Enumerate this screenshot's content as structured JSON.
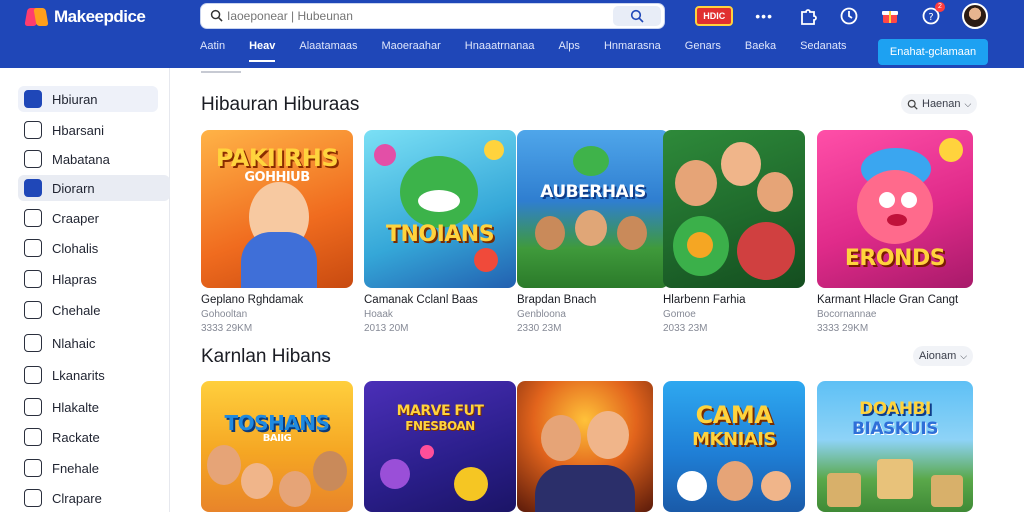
{
  "header": {
    "logo_text": "Makeepdice",
    "search_placeholder": "Iaoeponear | Hubeunan",
    "badge_text": "HDIC",
    "notif_count": "2",
    "nav_tabs": [
      "Aatin",
      "Heav",
      "Alaatamaas",
      "Maoeraahar",
      "Hnaaatrnanaa",
      "Alps",
      "Hnmarasna",
      "Genars",
      "Baeka",
      "Sedanats"
    ],
    "cta_label": "Enahat-gclamaan"
  },
  "sidebar": {
    "items": [
      {
        "label": "Hbiuran",
        "icon": "home-icon"
      },
      {
        "label": "Hbarsani",
        "icon": "trend-icon"
      },
      {
        "label": "Mabatana",
        "icon": "mail-icon"
      },
      {
        "label": "Diorarn",
        "icon": "play-icon"
      },
      {
        "label": "Craaper",
        "icon": "chat-icon"
      },
      {
        "label": "Clohalis",
        "icon": "calendar-icon"
      },
      {
        "label": "Hlapras",
        "icon": "flag-icon"
      },
      {
        "label": "Chehale",
        "icon": "chart-icon"
      },
      {
        "label": "Nlahaic",
        "icon": "music-icon"
      },
      {
        "label": "Lkanarits",
        "icon": "bell-icon"
      },
      {
        "label": "Hlakalte",
        "icon": "heart-icon"
      },
      {
        "label": "Rackate",
        "icon": "gauge-icon"
      },
      {
        "label": "Fnehale",
        "icon": "search-icon"
      },
      {
        "label": "Clrapare",
        "icon": "bag-icon"
      }
    ]
  },
  "sections": [
    {
      "title": "Hibauran Hiburaas",
      "sort_label": "Haenan",
      "cards": [
        {
          "title": "Geplano Rghdamak",
          "cat": "Gohooltan",
          "size": "3333 29KM",
          "art_text": "PAKIIRHS",
          "art_sub": "GOHHIUB"
        },
        {
          "title": "Camanak Cclanl Baas",
          "cat": "Hoaak",
          "size": "2013 20M",
          "art_text": "TNOIANS",
          "art_sub": ""
        },
        {
          "title": "Brapdan Bnach",
          "cat": "Genbloona",
          "size": "2330 23M",
          "art_text": "AUBERHAIS",
          "art_sub": ""
        },
        {
          "title": "Hlarbenn Farhia",
          "cat": "Gomoe",
          "size": "2033 23M",
          "art_text": "",
          "art_sub": ""
        },
        {
          "title": "Karmant Hlacle Gran Cangt",
          "cat": "Bocornannae",
          "size": "3333 29KM",
          "art_text": "ERONDS",
          "art_sub": ""
        }
      ]
    },
    {
      "title": "Karnlan Hibans",
      "sort_label": "Aionam",
      "cards": [
        {
          "art_text": "TOSHANS",
          "art_sub": "BAIIG"
        },
        {
          "art_text": "MARVE FUT",
          "art_sub": "FNESBOAN"
        },
        {
          "art_text": "",
          "art_sub": ""
        },
        {
          "art_text": "CAMA",
          "art_sub": "MKNIAIS"
        },
        {
          "art_text": "DOAHBI",
          "art_sub": "BIASKUIS"
        }
      ]
    }
  ]
}
